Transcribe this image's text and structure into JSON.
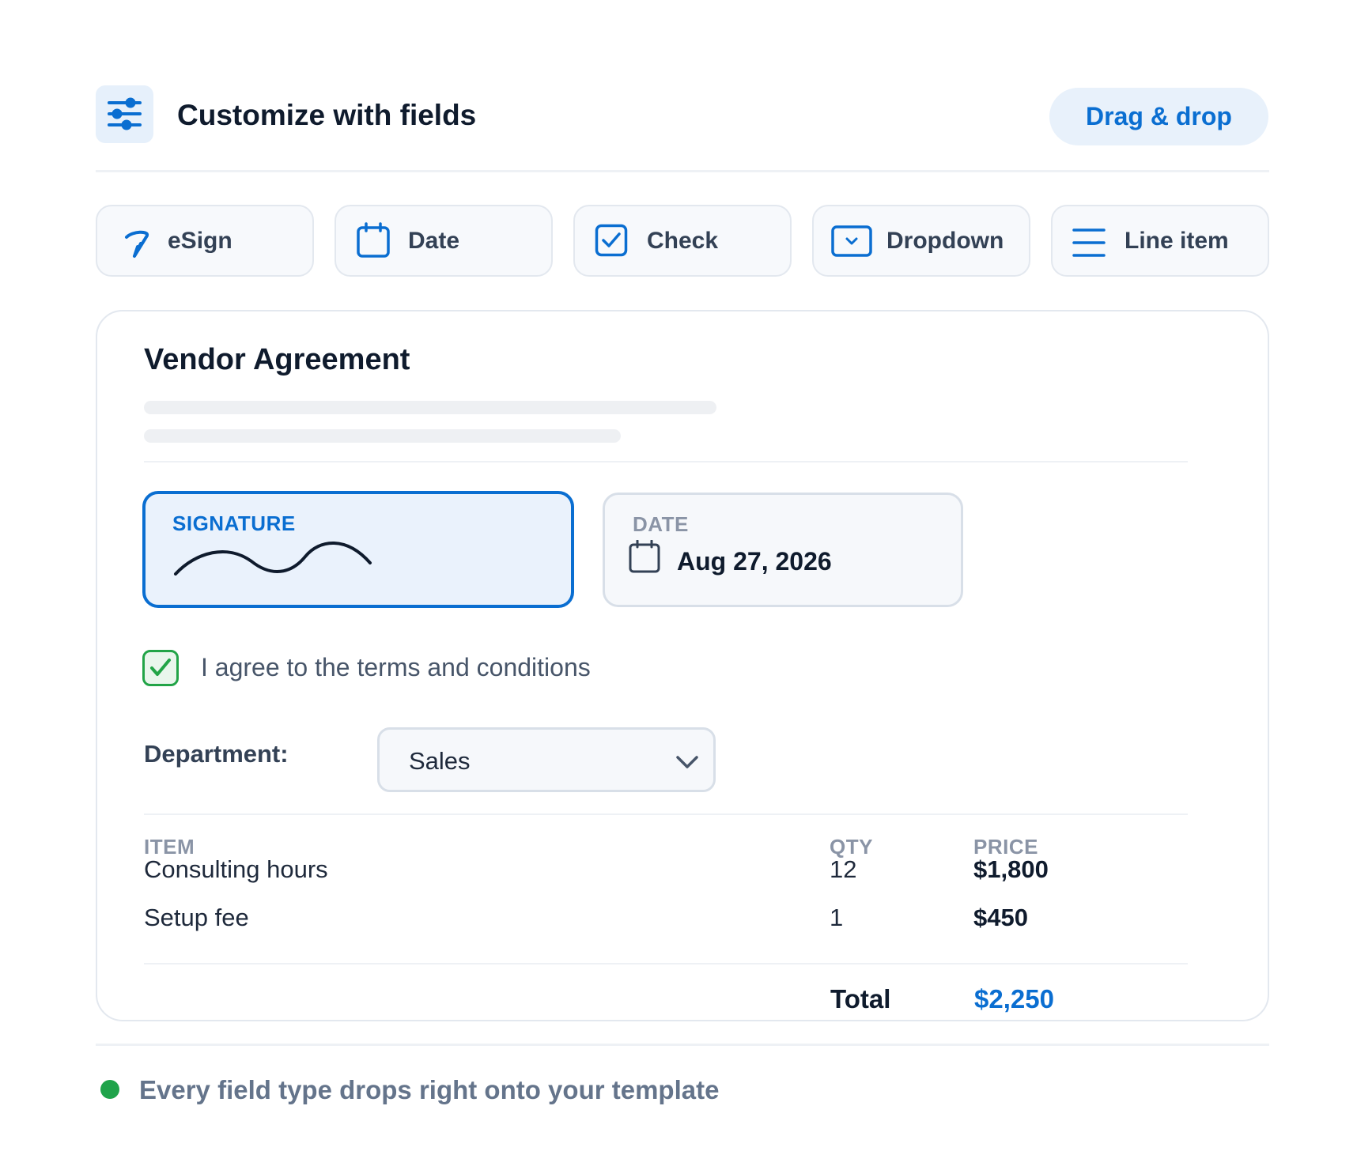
{
  "header": {
    "icon": "sliders-icon",
    "title": "Customize with fields",
    "action_label": "Drag & drop"
  },
  "fields": [
    {
      "label": "eSign",
      "icon": "pen-icon"
    },
    {
      "label": "Date",
      "icon": "calendar-icon"
    },
    {
      "label": "Check",
      "icon": "checkbox-icon"
    },
    {
      "label": "Dropdown",
      "icon": "dropdown-icon"
    },
    {
      "label": "Line item",
      "icon": "lines-icon"
    }
  ],
  "document": {
    "title": "Vendor Agreement",
    "signature_label": "SIGNATURE",
    "date_label": "DATE",
    "date_value": "Aug 27, 2026",
    "agree_text": "I agree to the terms and conditions",
    "agree_checked": true,
    "department_label": "Department:",
    "department_value": "Sales",
    "table": {
      "headers": [
        "ITEM",
        "QTY",
        "PRICE"
      ],
      "rows": [
        {
          "item": "Consulting hours",
          "qty": "12",
          "price": "$1,800"
        },
        {
          "item": "Setup fee",
          "qty": "1",
          "price": "$450"
        }
      ],
      "total_label": "Total",
      "total_value": "$2,250"
    }
  },
  "footer": {
    "text": "Every field type drops right onto your template",
    "status_color": "#1fa34a"
  },
  "colors": {
    "accent": "#0a6ed1",
    "success": "#22a447"
  }
}
